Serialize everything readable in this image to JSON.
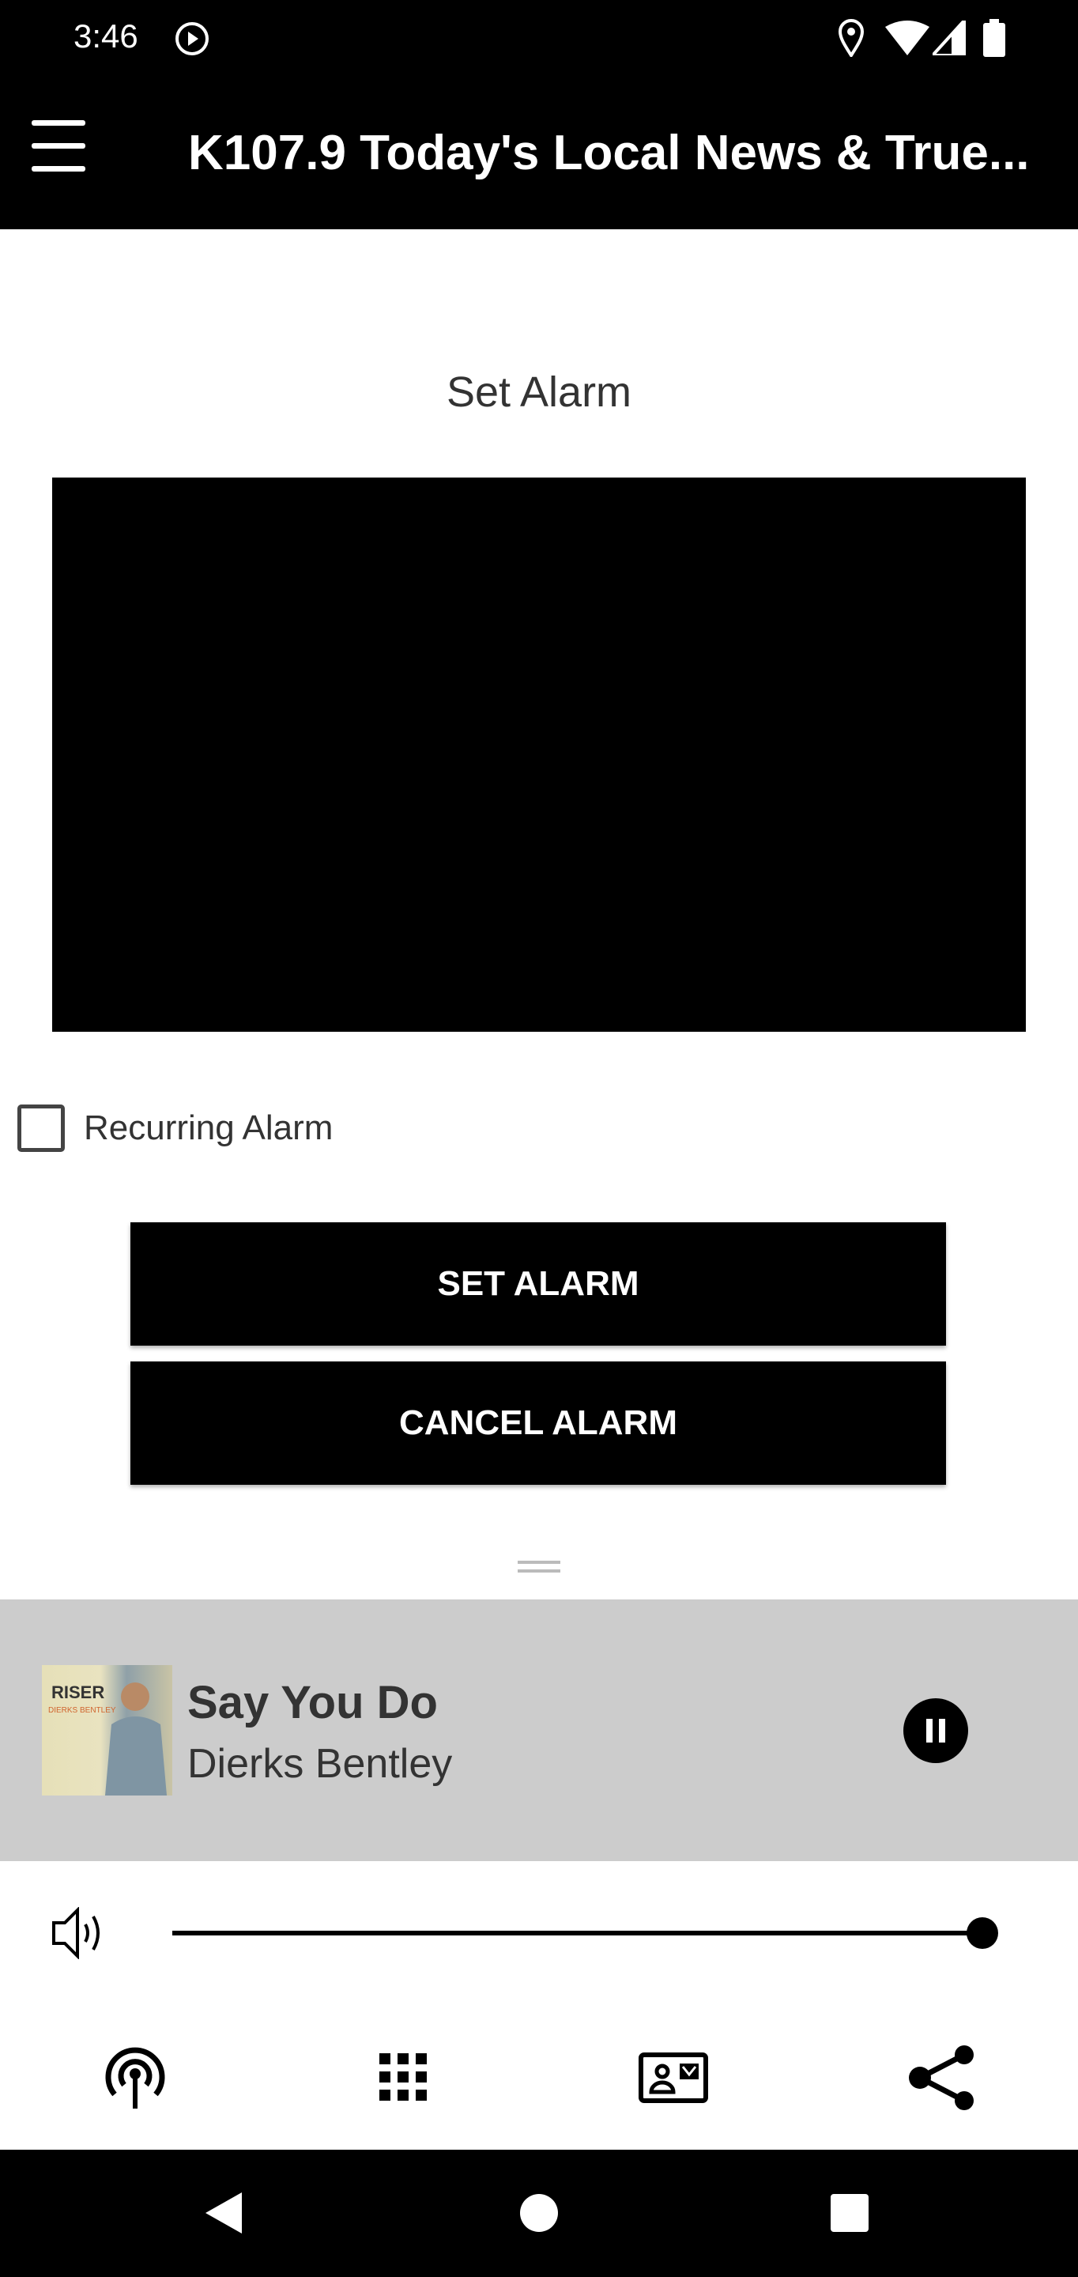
{
  "status_bar": {
    "time": "3:46",
    "icons": [
      "media-play-icon",
      "location-icon",
      "wifi-icon",
      "signal-icon",
      "battery-icon"
    ]
  },
  "app_bar": {
    "title": "K107.9 Today's Local News & True..."
  },
  "page": {
    "heading": "Set Alarm",
    "recurring_label": "Recurring Alarm",
    "recurring_checked": false,
    "set_button": "SET ALARM",
    "cancel_button": "CANCEL ALARM"
  },
  "player": {
    "song": "Say You Do",
    "artist": "Dierks Bentley",
    "album_art_text": "RISER DIERKS BENTLEY",
    "state": "playing",
    "volume_percent": 100
  },
  "colors": {
    "bar": "#000000",
    "player_bg": "#cccccc"
  },
  "bottom_nav": [
    "podcast-icon",
    "grid-icon",
    "contact-card-icon",
    "share-icon"
  ]
}
